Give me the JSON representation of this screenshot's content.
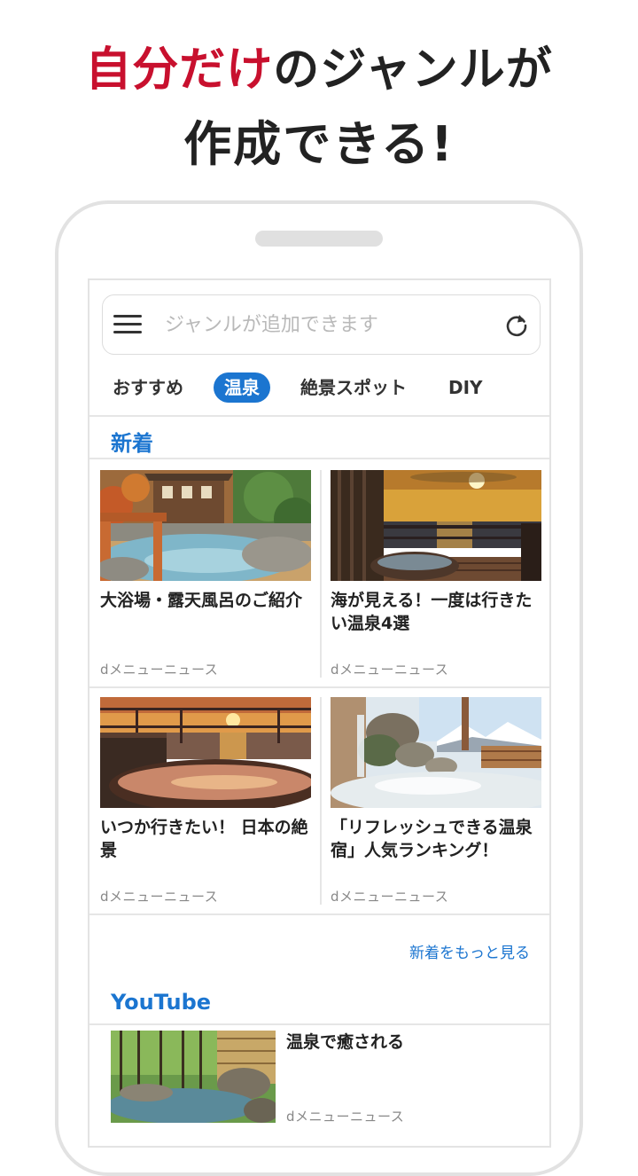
{
  "headline": {
    "line1_accent": "自分だけ",
    "line1_rest": "のジャンルが",
    "line2": "作成できる!"
  },
  "search": {
    "placeholder": "ジャンルが追加できます"
  },
  "tabs": [
    {
      "label": "おすすめ",
      "active": false
    },
    {
      "label": "温泉",
      "active": true
    },
    {
      "label": "絶景スポット",
      "active": false
    },
    {
      "label": "DIY",
      "active": false
    }
  ],
  "sections": {
    "new": {
      "title": "新着",
      "more_link": "新着をもっと見る",
      "articles": [
        {
          "title": "大浴場・露天風呂のご紹介",
          "source": "dメニューニュース"
        },
        {
          "title": "海が見える！一度は行きたい温泉4選",
          "source": "dメニューニュース"
        },
        {
          "title": "いつか行きたい！ 日本の絶景",
          "source": "dメニューニュース"
        },
        {
          "title": "「リフレッシュできる温泉宿」人気ランキング！",
          "source": "dメニューニュース"
        }
      ]
    },
    "youtube": {
      "title": "YouTube",
      "items": [
        {
          "title": "温泉で癒される",
          "source": "dメニューニュース"
        }
      ]
    }
  },
  "colors": {
    "accent_red": "#c8102e",
    "brand_blue": "#1b75d0"
  }
}
